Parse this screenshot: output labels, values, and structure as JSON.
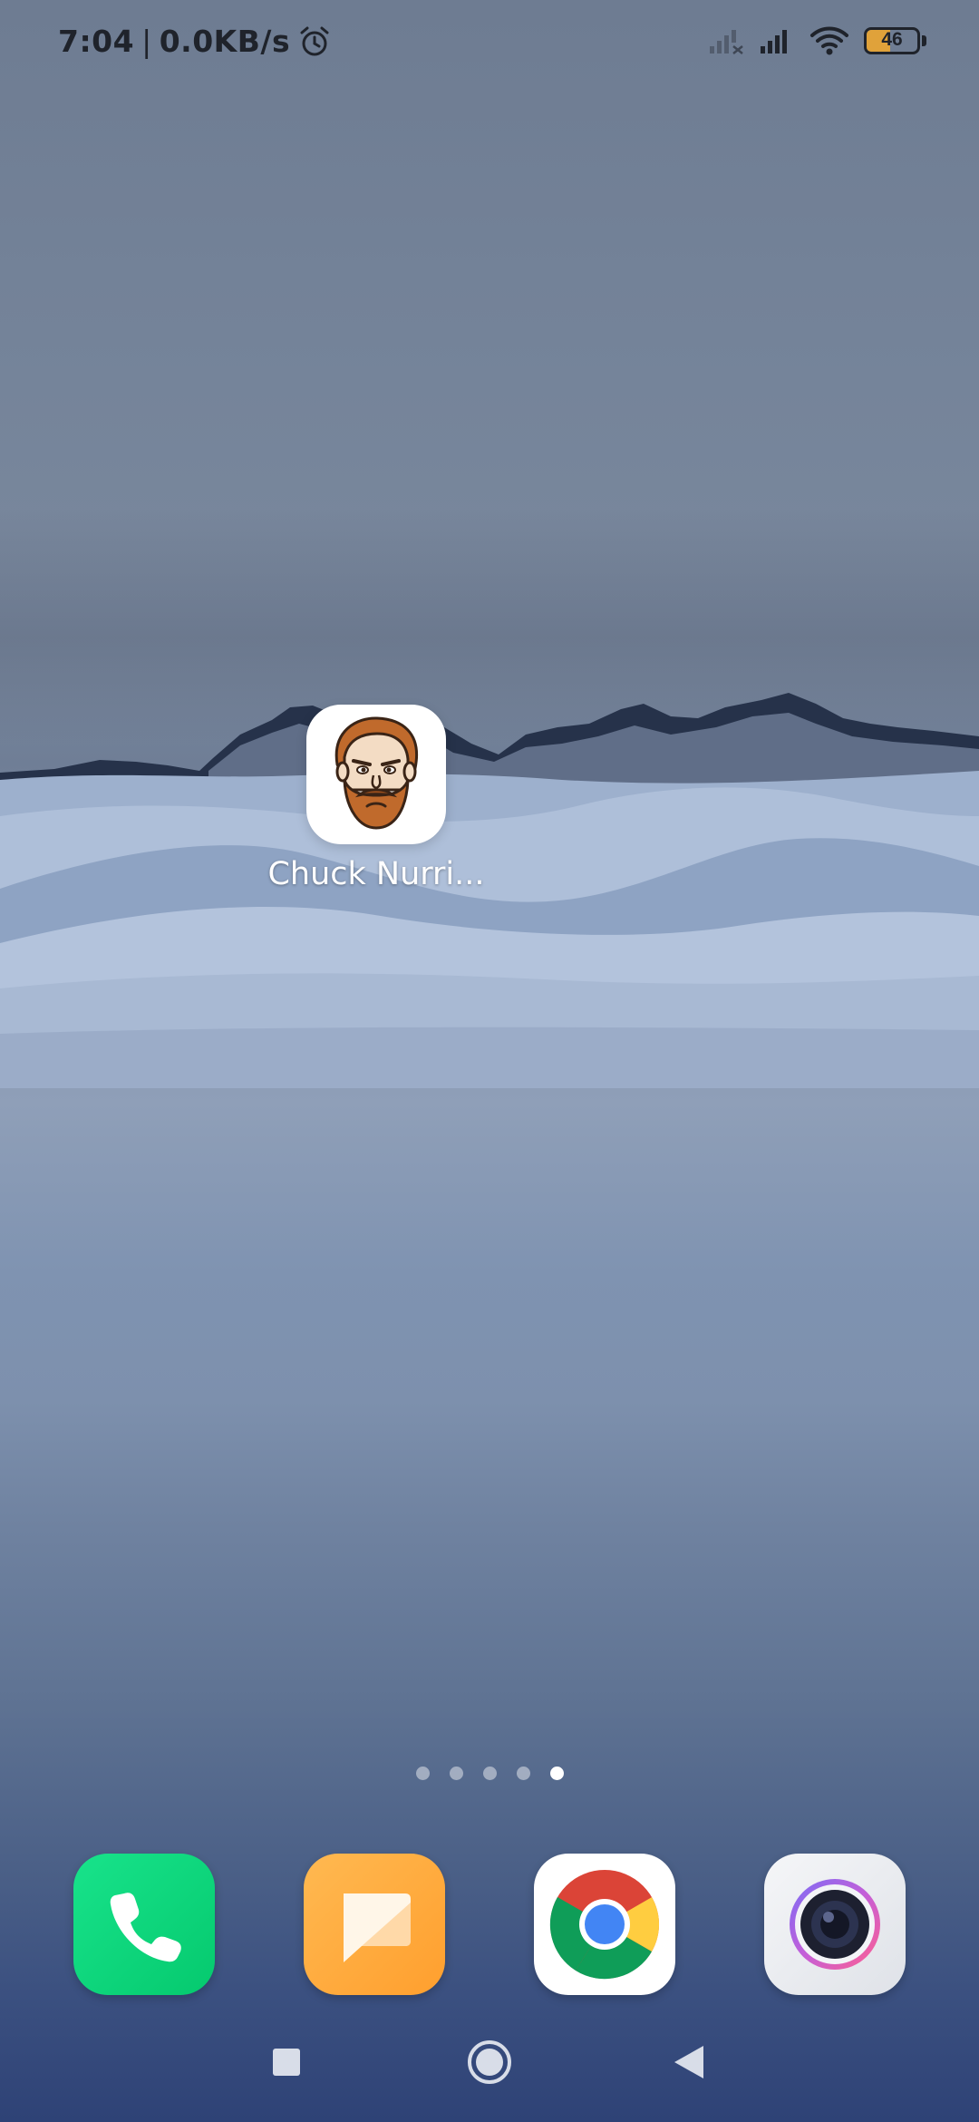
{
  "status_bar": {
    "time": "7:04",
    "separator": "|",
    "network_speed": "0.0KB/s",
    "alarm_icon": "alarm-clock-icon",
    "sim_icon": "no-signal-icon",
    "signal_icon": "cell-signal-icon",
    "wifi_icon": "wifi-icon",
    "battery_level": "46",
    "battery_fraction": 0.46,
    "battery_color": "#e0a23a"
  },
  "home": {
    "apps": [
      {
        "label": "Chuck Nurri...",
        "icon": "chuck-norris-face-icon"
      }
    ],
    "page_count": 5,
    "active_page": 5
  },
  "dock": [
    {
      "name": "Phone",
      "icon": "phone-icon",
      "color": "#05c96e"
    },
    {
      "name": "Messages",
      "icon": "messages-icon",
      "color": "#ff9f2e"
    },
    {
      "name": "Chrome",
      "icon": "chrome-icon",
      "color": "#ffffff"
    },
    {
      "name": "Camera",
      "icon": "camera-icon",
      "color": "#dfe2e8"
    }
  ],
  "nav_bar": {
    "recents_icon": "square-recents-icon",
    "home_icon": "circle-home-icon",
    "back_icon": "triangle-back-icon"
  }
}
